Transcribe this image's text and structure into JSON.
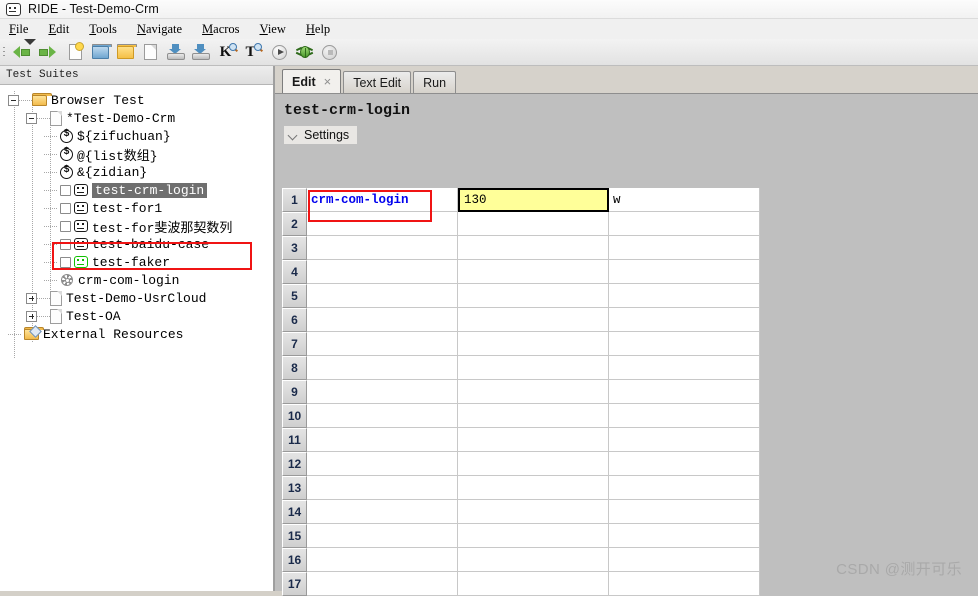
{
  "window": {
    "title": "RIDE - Test-Demo-Crm",
    "icon": "robot-icon"
  },
  "menubar": {
    "items": [
      {
        "label": "File",
        "mnemonic": "F"
      },
      {
        "label": "Edit",
        "mnemonic": "E"
      },
      {
        "label": "Tools",
        "mnemonic": "T"
      },
      {
        "label": "Navigate",
        "mnemonic": "N"
      },
      {
        "label": "Macros",
        "mnemonic": "M"
      },
      {
        "label": "View",
        "mnemonic": "V"
      },
      {
        "label": "Help",
        "mnemonic": "H"
      }
    ]
  },
  "toolbar": {
    "overflow_label": "toolbar-overflow",
    "buttons": [
      {
        "name": "back-button",
        "icon": "arrow-left-icon",
        "tooltip": "Back"
      },
      {
        "name": "forward-button",
        "icon": "arrow-right-icon",
        "tooltip": "Forward"
      },
      {
        "name": "new-project-button",
        "icon": "new-page-icon",
        "tooltip": "New Project"
      },
      {
        "name": "open-project-button",
        "icon": "open-folder-icon",
        "tooltip": "Open Project"
      },
      {
        "name": "open-directory-button",
        "icon": "folder-icon",
        "tooltip": "Open Directory"
      },
      {
        "name": "new-file-button",
        "icon": "page-icon",
        "tooltip": "New File"
      },
      {
        "name": "save-button",
        "icon": "save-icon",
        "tooltip": "Save"
      },
      {
        "name": "save-all-button",
        "icon": "save-all-icon",
        "tooltip": "Save All"
      },
      {
        "name": "search-keyword-button",
        "icon": "keyword-search-icon",
        "label": "K",
        "tooltip": "Search Keywords"
      },
      {
        "name": "search-tests-button",
        "icon": "test-search-icon",
        "label": "T",
        "tooltip": "Search Tests"
      },
      {
        "name": "run-button",
        "icon": "play-icon",
        "tooltip": "Run"
      },
      {
        "name": "debug-button",
        "icon": "bug-icon",
        "tooltip": "Debug"
      },
      {
        "name": "stop-button",
        "icon": "stop-icon",
        "tooltip": "Stop"
      }
    ]
  },
  "sidebar": {
    "header": "Test Suites",
    "tree": [
      {
        "label": "Browser Test",
        "icon": "folder-icon",
        "depth": 0,
        "expander": "minus",
        "checkbox": false,
        "selected": false
      },
      {
        "label": "*Test-Demo-Crm",
        "icon": "document-icon",
        "depth": 1,
        "expander": "minus",
        "checkbox": false,
        "selected": false
      },
      {
        "label": "${zifuchuan}",
        "icon": "variable-icon",
        "depth": 2,
        "expander": "none",
        "checkbox": false,
        "selected": false
      },
      {
        "label": "@{list数组}",
        "icon": "variable-icon",
        "depth": 2,
        "expander": "none",
        "checkbox": false,
        "selected": false
      },
      {
        "label": "&{zidian}",
        "icon": "variable-icon",
        "depth": 2,
        "expander": "none",
        "checkbox": false,
        "selected": false
      },
      {
        "label": "test-crm-login",
        "icon": "testcase-icon",
        "depth": 2,
        "expander": "none",
        "checkbox": true,
        "selected": true,
        "highlighted": true
      },
      {
        "label": "test-for1",
        "icon": "testcase-icon",
        "depth": 2,
        "expander": "none",
        "checkbox": true,
        "selected": false
      },
      {
        "label": "test-for斐波那契数列",
        "icon": "testcase-icon",
        "depth": 2,
        "expander": "none",
        "checkbox": true,
        "selected": false
      },
      {
        "label": "test-baidu-case",
        "icon": "testcase-icon",
        "depth": 2,
        "expander": "none",
        "checkbox": true,
        "selected": false
      },
      {
        "label": "test-faker",
        "icon": "testcase-icon-green",
        "depth": 2,
        "expander": "none",
        "checkbox": true,
        "selected": false
      },
      {
        "label": "crm-com-login",
        "icon": "keyword-gear-icon",
        "depth": 2,
        "expander": "none",
        "checkbox": false,
        "selected": false
      },
      {
        "label": "Test-Demo-UsrCloud",
        "icon": "document-icon",
        "depth": 1,
        "expander": "plus",
        "checkbox": false,
        "selected": false
      },
      {
        "label": "Test-OA",
        "icon": "document-icon",
        "depth": 1,
        "expander": "plus",
        "checkbox": false,
        "selected": false
      },
      {
        "label": "External Resources",
        "icon": "external-folder-icon",
        "depth": 0,
        "expander": "none",
        "checkbox": false,
        "selected": false
      }
    ]
  },
  "editor": {
    "tabs": [
      {
        "label": "Edit",
        "active": true,
        "closable": true
      },
      {
        "label": "Text Edit",
        "active": false,
        "closable": false
      },
      {
        "label": "Run",
        "active": false,
        "closable": false
      }
    ],
    "close_glyph": "×",
    "title": "test-crm-login",
    "settings_label": "Settings",
    "settings_icon": "chevron-down-icon",
    "grid": {
      "row_numbers": [
        "1",
        "2",
        "3",
        "4",
        "5",
        "6",
        "7",
        "8",
        "9",
        "10",
        "11",
        "12",
        "13",
        "14",
        "15",
        "16",
        "17"
      ],
      "rows": [
        {
          "number": "1",
          "cells": [
            {
              "value": "crm-com-login",
              "style": "keyword",
              "annotated": true
            },
            {
              "value": "130",
              "style": "selected-yellow",
              "blurred": true
            },
            {
              "value": "w",
              "style": "plain",
              "blurred": true
            },
            {
              "value": "",
              "style": "inactive"
            },
            {
              "value": "",
              "style": "inactive"
            }
          ]
        }
      ]
    }
  },
  "annotations": {
    "highlight_color": "#f01414",
    "boxes": [
      {
        "name": "tree-selection-highlight-box",
        "target": "test-crm-login tree item"
      },
      {
        "name": "grid-keyword-highlight-box",
        "target": "crm-com-login grid cell"
      }
    ]
  },
  "watermark": "CSDN @测开可乐"
}
